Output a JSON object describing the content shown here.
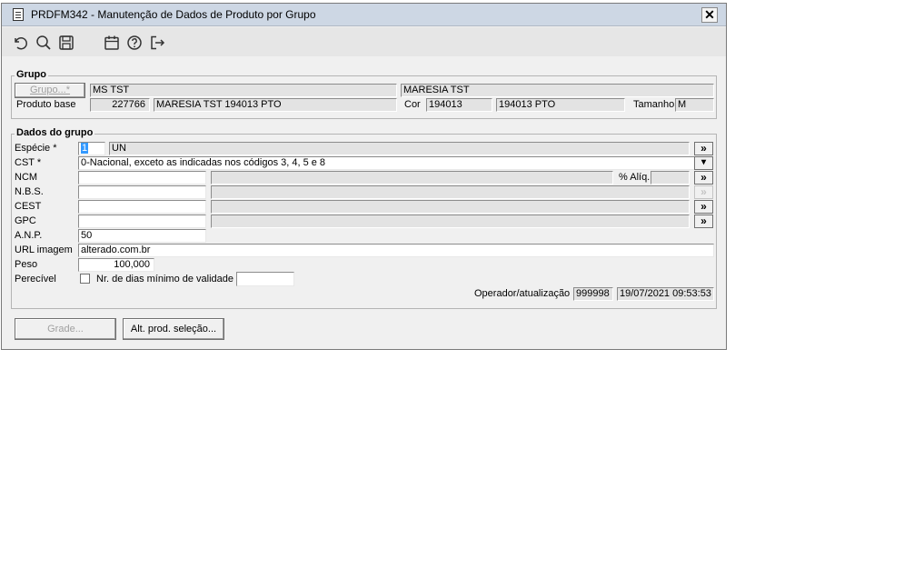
{
  "window": {
    "title": "PRDFM342 - Manutenção de Dados de Produto por Grupo",
    "close_label": "✕"
  },
  "toolbar": {
    "icons": [
      "undo-icon",
      "search-icon",
      "save-icon",
      "calendar-icon",
      "help-icon",
      "exit-icon"
    ]
  },
  "grupo": {
    "legend": "Grupo",
    "grupo_button": "Grupo...*",
    "grupo_code": "MS TST",
    "grupo_desc": "MARESIA TST",
    "produto_base_label": "Produto base",
    "produto_base_code": "227766",
    "produto_base_desc": "MARESIA TST 194013 PTO",
    "cor_label": "Cor",
    "cor_code": "194013",
    "cor_desc": "194013 PTO",
    "tamanho_label": "Tamanho",
    "tamanho_value": "M"
  },
  "dados": {
    "legend": "Dados do grupo",
    "especie_label": "Espécie *",
    "especie_code": "1",
    "especie_desc": "UN",
    "cst_label": "CST *",
    "cst_value": "0-Nacional, exceto as indicadas nos códigos 3, 4, 5 e 8",
    "ncm_label": "NCM",
    "ncm_value": "",
    "aliq_label": "% Alíq.",
    "aliq_value": "",
    "nbs_label": "N.B.S.",
    "nbs_value": "",
    "cest_label": "CEST",
    "cest_value": "",
    "gpc_label": "GPC",
    "gpc_value": "",
    "anp_label": "A.N.P.",
    "anp_value": "50",
    "url_label": "URL imagem",
    "url_value": "alterado.com.br",
    "peso_label": "Peso",
    "peso_value": "100,000",
    "perecivel_label": "Perecível",
    "perecivel_checked": false,
    "dias_label": "Nr. de dias mínimo de validade",
    "dias_value": "",
    "operador_label": "Operador/atualização",
    "operador_value": "999998",
    "atualizacao_value": "19/07/2021 09:53:53",
    "lookup_label": "»",
    "dropdown_label": "▾"
  },
  "footer": {
    "grade_button": "Grade...",
    "alt_prod_button": "Alt. prod. seleção..."
  }
}
